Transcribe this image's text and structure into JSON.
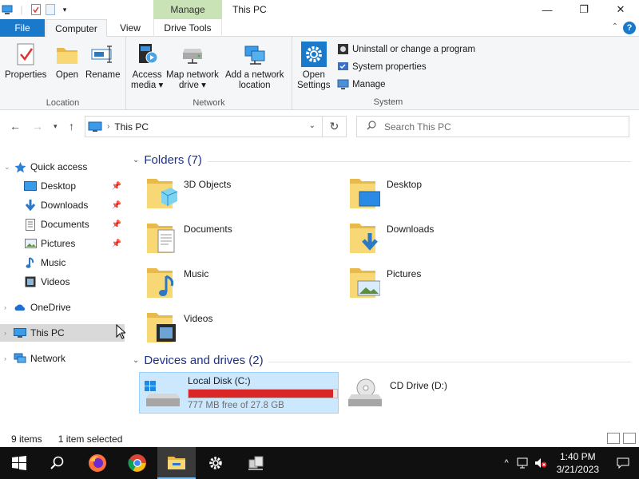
{
  "window": {
    "title": "This PC",
    "contextual_tab_group": "Manage",
    "minimize_glyph": "—",
    "maximize_glyph": "❐",
    "close_glyph": "✕"
  },
  "ribbon_tabs": {
    "file": "File",
    "computer": "Computer",
    "view": "View",
    "drive_tools": "Drive Tools",
    "help": "?"
  },
  "ribbon": {
    "location": {
      "label": "Location",
      "properties": "Properties",
      "open": "Open",
      "rename": "Rename"
    },
    "network": {
      "label": "Network",
      "access_media_1": "Access",
      "access_media_2": "media ▾",
      "map_drive_1": "Map network",
      "map_drive_2": "drive ▾",
      "add_location_1": "Add a network",
      "add_location_2": "location"
    },
    "system": {
      "label": "System",
      "open_settings_1": "Open",
      "open_settings_2": "Settings",
      "uninstall": "Uninstall or change a program",
      "system_properties": "System properties",
      "manage": "Manage"
    }
  },
  "address_bar": {
    "crumb": "This PC",
    "search_placeholder": "Search This PC"
  },
  "nav_pane": {
    "quick_access": "Quick access",
    "items": [
      {
        "label": "Desktop",
        "pinned": true
      },
      {
        "label": "Downloads",
        "pinned": true
      },
      {
        "label": "Documents",
        "pinned": true
      },
      {
        "label": "Pictures",
        "pinned": true
      },
      {
        "label": "Music",
        "pinned": false
      },
      {
        "label": "Videos",
        "pinned": false
      }
    ],
    "onedrive": "OneDrive",
    "this_pc": "This PC",
    "network": "Network"
  },
  "content": {
    "folders_header": "Folders (7)",
    "folders": [
      "3D Objects",
      "Desktop",
      "Documents",
      "Downloads",
      "Music",
      "Pictures",
      "Videos"
    ],
    "drives_header": "Devices and drives (2)",
    "drives": [
      {
        "name": "Local Disk (C:)",
        "free": "777 MB free of 27.8 GB",
        "used_fraction": 0.973,
        "bar_color": "#da2626"
      },
      {
        "name": "CD Drive (D:)"
      }
    ]
  },
  "status_bar": {
    "items_count": "9 items",
    "selection": "1 item selected"
  },
  "taskbar": {
    "time": "1:40 PM",
    "date": "3/21/2023"
  },
  "colors": {
    "accent": "#1979ca",
    "manage_tab": "#c9e3b6",
    "selection": "#cce8ff",
    "section_header": "#1e3287",
    "folder_yellow": "#f8d775"
  }
}
